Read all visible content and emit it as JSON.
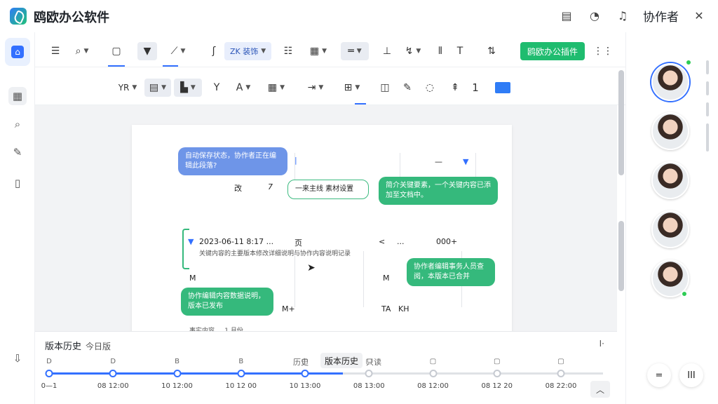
{
  "app": {
    "title": "鸥欧办公软件",
    "accent": "#3370ff",
    "green": "#1fbc6f"
  },
  "titlebar": {
    "icons": [
      "comment-icon",
      "notification-icon",
      "bell-icon",
      "close-icon"
    ],
    "collaborators_label": "协作者"
  },
  "toolbar1": {
    "font_dropdown": "ZK 装饰",
    "action_button": "鸥欧办公插件",
    "more": "⋮⋮"
  },
  "toolbar2": {
    "font_label": "YR",
    "number": "1"
  },
  "document": {
    "bubble_top_left": "自动保存状态，协作者正在编辑此段落?",
    "col_a": "改",
    "col_b": "7",
    "boxed_label": "一来主线    素材设置",
    "bubble_right": "简介关键要素，一个关键内容已添加至文档中。",
    "date_line": "2023-06-11 8:17 ...",
    "date_tag": "页",
    "date_mark": "<",
    "date_dots": "...",
    "date_end": "000+",
    "desc_line": "关键内容的主要版本修改详细说明与协作内容说明记录",
    "row_m1": "M",
    "row_m2": "M",
    "bubble_right2": "协作者编辑事务人员查阅，本版本已合并",
    "bubble_green_left": "协作编辑内容数据说明，版本已发布",
    "row_mplus": "M+",
    "row_ta": "TA",
    "row_kh": "KH",
    "row_bottom": "事实内容 ... 1 月份"
  },
  "history": {
    "title": "版本历史",
    "subtitle": "今日版",
    "collapse": "I·",
    "popup": "版本历史",
    "meta_left": "历史",
    "meta_right": "只读",
    "ticks": [
      "D",
      "D",
      "B",
      "B",
      "",
      "",
      "",
      "",
      ""
    ],
    "times": [
      "0—1",
      "08 12:00",
      "10 12:00",
      "10 12 00",
      "10 13:00",
      "08 13:00",
      "08 12:00",
      "08 12 20",
      "08 22:00"
    ],
    "progress_fraction": 0.53
  },
  "collaborators": {
    "count": 5,
    "online": [
      true,
      false,
      false,
      false,
      true
    ]
  },
  "footer_buttons": {
    "left": "=",
    "right": "III"
  }
}
